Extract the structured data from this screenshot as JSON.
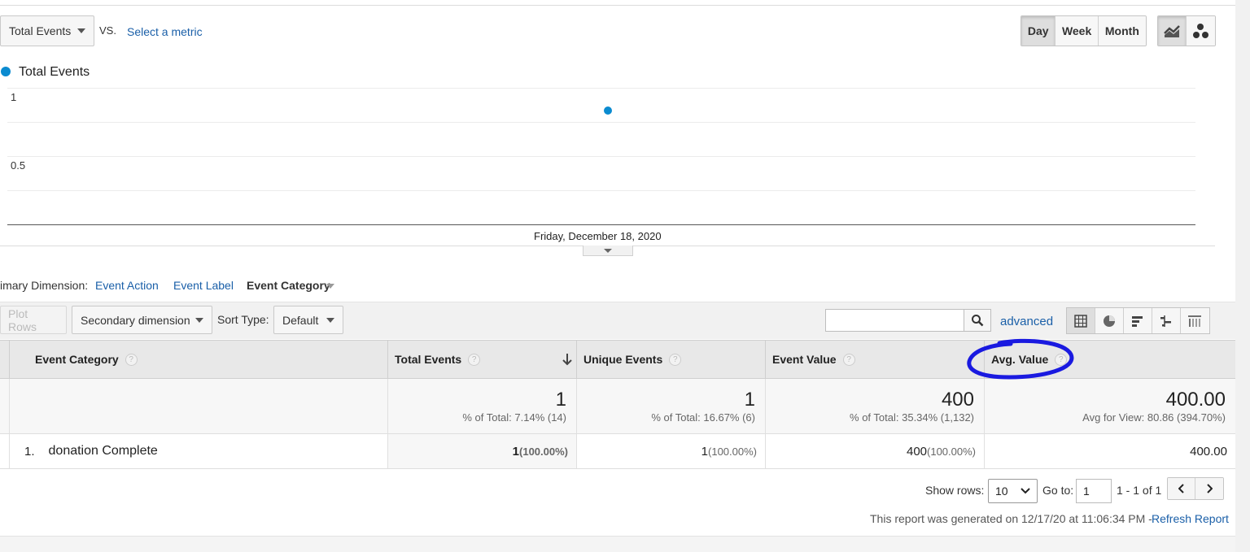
{
  "chart_header": {
    "metric_select": "Total Events",
    "vs_label": "VS.",
    "select_metric_link": "Select a metric",
    "period_buttons": [
      "Day",
      "Week",
      "Month"
    ],
    "active_period": "Day"
  },
  "chart_data": {
    "type": "line",
    "series": [
      {
        "name": "Total Events",
        "values": [
          1
        ]
      }
    ],
    "x": [
      "Friday, December 18, 2020"
    ],
    "xlabel": "",
    "ylabel": "",
    "yticks": [
      "1",
      "0.5"
    ],
    "ylim": [
      0,
      1.2
    ],
    "grid": true,
    "legend": "top-left",
    "color": "#0b8bd0"
  },
  "dimension_bar": {
    "label": "imary Dimension:",
    "options": [
      "Event Action",
      "Event Label"
    ],
    "active": "Event Category"
  },
  "toolbar": {
    "plot_rows": "Plot Rows",
    "secondary_dimension": "Secondary dimension",
    "sort_type_label": "Sort Type:",
    "sort_type_value": "Default",
    "search_placeholder": "",
    "advanced_link": "advanced"
  },
  "table": {
    "headers": {
      "category": "Event Category",
      "total_events": "Total Events",
      "unique_events": "Unique Events",
      "event_value": "Event Value",
      "avg_value": "Avg. Value"
    },
    "totals": {
      "total_events": "1",
      "total_events_sub": "% of Total: 7.14% (14)",
      "unique_events": "1",
      "unique_events_sub": "% of Total: 16.67% (6)",
      "event_value": "400",
      "event_value_sub": "% of Total: 35.34% (1,132)",
      "avg_value": "400.00",
      "avg_value_sub": "Avg for View: 80.86 (394.70%)"
    },
    "rows": [
      {
        "index": "1.",
        "category": "donation Complete",
        "total_events": "1",
        "total_events_pct": "(100.00%)",
        "unique_events": "1",
        "unique_events_pct": "(100.00%)",
        "event_value": "400",
        "event_value_pct": "(100.00%)",
        "avg_value": "400.00"
      }
    ]
  },
  "pagination": {
    "show_rows_label": "Show rows:",
    "show_rows_value": "10",
    "goto_label": "Go to:",
    "goto_value": "1",
    "range": "1 - 1 of 1"
  },
  "footer": {
    "generated": "This report was generated on 12/17/20 at 11:06:34 PM -",
    "refresh": "Refresh Report"
  },
  "colors": {
    "accent": "#1a5fa8",
    "series": "#0b8bd0",
    "annotation": "#1a1ae0"
  }
}
